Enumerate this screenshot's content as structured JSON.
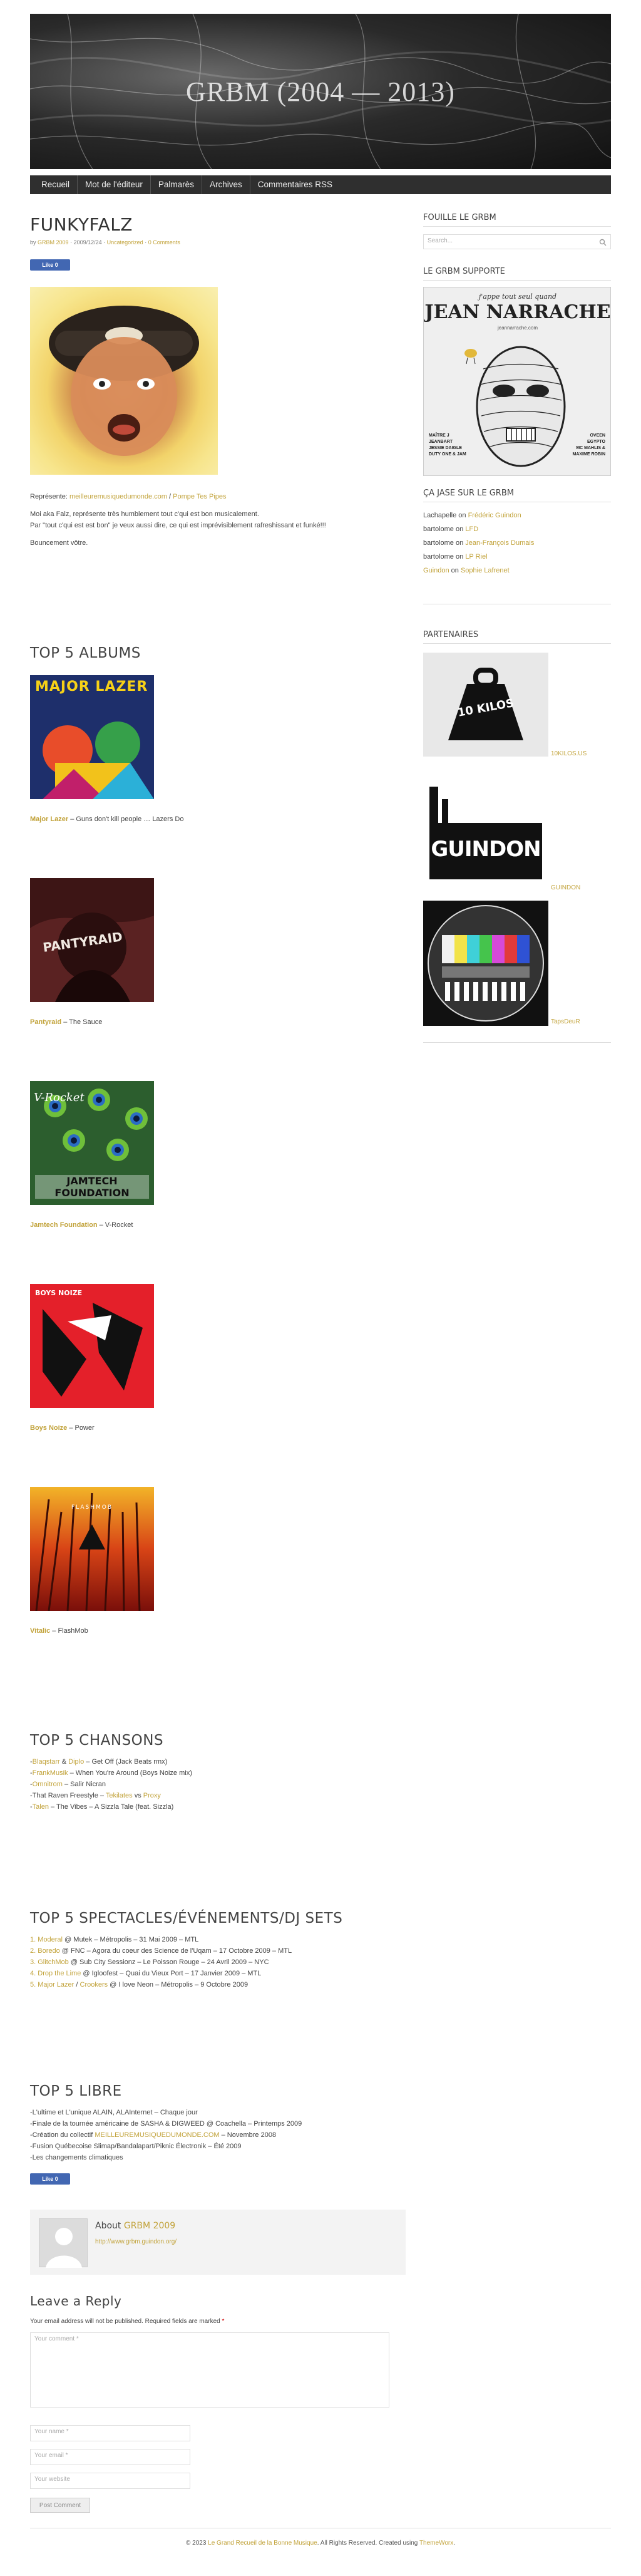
{
  "header": {
    "title": "GRBM (2004 — 2013)"
  },
  "nav": [
    "Recueil",
    "Mot de l'éditeur",
    "Palmarès",
    "Archives",
    "Commentaires RSS"
  ],
  "post": {
    "title": "FUNKYFALZ",
    "meta_by": "by",
    "meta_author": "GRBM 2009",
    "meta_date": "· 2009/12/24 ·",
    "meta_category": "Uncategorized",
    "meta_sep": "·",
    "meta_comments": "0 Comments",
    "like": "Like 0",
    "rep_prefix": "Représente:",
    "rep_link1": "meilleuremusiquedumonde.com",
    "rep_sep": "/",
    "rep_link2": "Pompe Tes Pipes",
    "body1": "Moi aka Falz, représente très humblement tout c'qui est bon musicalement.",
    "body2": "Par \"tout c'qui est est bon\" je veux aussi dire, ce qui est imprévisiblement rafreshissant et funké!!!",
    "body3": "Bouncement vôtre."
  },
  "top_albums": {
    "title": "TOP 5 ALBUMS",
    "items": [
      {
        "artist": "Major Lazer",
        "rest": " – Guns don't kill people … Lazers Do",
        "cover_text": "MAJOR LAZER"
      },
      {
        "artist": "Pantyraid",
        "rest": " – The Sauce",
        "cover_text": "PANTYRAID"
      },
      {
        "artist": "Jamtech Foundation",
        "rest": " – V-Rocket",
        "cover_text": "JAMTECH FOUNDATION"
      },
      {
        "artist": "Boys Noize",
        "rest": " – Power",
        "cover_text": "BOYS NOIZE"
      },
      {
        "artist": "Vitalic",
        "rest": " – FlashMob",
        "cover_text": "FLASHMOB"
      }
    ],
    "cover_text_v_rocket": "V-Rocket"
  },
  "top_songs": {
    "title": "TOP 5 CHANSONS",
    "items": [
      {
        "pre": "-",
        "a1": "Blaqstarr",
        "mid": " & ",
        "a2": "Diplo",
        "rest": " – Get Off (Jack Beats rmx)"
      },
      {
        "pre": "-",
        "a1": "FrankMusik",
        "mid": "",
        "a2": "",
        "rest": " – When You're Around (Boys Noize mix)"
      },
      {
        "pre": "-",
        "a1": "Omnitrom",
        "mid": "",
        "a2": "",
        "rest": " – Salir Nicran"
      },
      {
        "pre": "-That Raven Freestyle – ",
        "a1": "Tekilates",
        "mid": " vs ",
        "a2": "Proxy",
        "rest": ""
      },
      {
        "pre": "-",
        "a1": "Talen",
        "mid": "",
        "a2": "",
        "rest": " – The Vibes – A Sizzla Tale (feat. Sizzla)"
      }
    ]
  },
  "top_shows": {
    "title": "TOP 5 SPECTACLES/ÉVÉNEMENTS/DJ SETS",
    "items": [
      {
        "n": "1.",
        "a1": "Moderal",
        "rest": " @ Mutek – Métropolis – 31 Mai 2009 – MTL"
      },
      {
        "n": "2.",
        "a1": "Boredo",
        "rest": " @ FNC – Agora du coeur des Science de l'Uqam – 17 Octobre 2009 – MTL"
      },
      {
        "n": "3.",
        "a1": "GlitchMob",
        "rest": " @ Sub City Sessionz – Le Poisson Rouge – 24 Avril 2009 – NYC"
      },
      {
        "n": "4.",
        "a1": "Drop the Lime",
        "rest": " @ Igloofest – Quai du Vieux Port – 17 Janvier 2009 – MTL"
      },
      {
        "n": "5.",
        "a1": "Major Lazer",
        "sep": " / ",
        "a2": "Crookers",
        "rest": " @ I love Neon – Métropolis – 9 Octobre 2009"
      }
    ]
  },
  "top_libre": {
    "title": "TOP 5 LIBRE",
    "items": [
      {
        "text": "-L'ultime et L'unique ALAIN, ALAInternet – Chaque jour"
      },
      {
        "text": "-Finale de la tournée américaine de SASHA & DIGWEED @ Coachella – Printemps 2009"
      },
      {
        "pre": "-Création du collectif ",
        "link": "MEILLEUREMUSIQUEDUMONDE.COM",
        "rest": " – Novembre 2008"
      },
      {
        "text": "-Fusion Québecoise Slimap/Bandalapart/Piknic Électronik – Été 2009"
      },
      {
        "text": "-Les changements climatiques"
      }
    ],
    "like": "Like 0"
  },
  "author": {
    "about": "About",
    "name": "GRBM 2009",
    "url": "http://www.grbm.guindon.org/"
  },
  "reply": {
    "title": "Leave a Reply",
    "note": "Your email address will not be published. Required fields are marked",
    "star": "*",
    "comment_ph": "Your comment *",
    "name_ph": "Your name *",
    "email_ph": "Your email *",
    "website_ph": "Your website",
    "submit": "Post Comment"
  },
  "sidebar": {
    "search_title": "FOUILLE LE GRBM",
    "search_ph": "Search...",
    "supporte_title": "LE GRBM SUPPORTE",
    "narrache": {
      "line1": "j'appe tout seul quand",
      "name": "JEAN NARRACHE",
      "url": "jeannarrache.com",
      "left": "MAÎTRE J\nJEANBART\nJESSIE DAIGLE\nDUTY ONE & JAM",
      "right": "OVEEN\nEGYPTO\nMC MAHLIS &\nMAXIME ROBIN"
    },
    "jase_title": "ÇA JASE SUR LE GRBM",
    "comments": [
      {
        "who": "Lachapelle",
        "on": " on ",
        "what": "Frédéric Guindon"
      },
      {
        "who": "bartolome",
        "on": " on ",
        "what": "LFD"
      },
      {
        "who": "bartolome",
        "on": " on ",
        "what": "Jean-François Dumais"
      },
      {
        "who": "bartolome",
        "on": " on ",
        "what": "LP Riel"
      },
      {
        "who_link": "Guindon",
        "on": " on ",
        "what": "Sophie Lafrenet"
      }
    ],
    "partners_title": "PARTENAIRES",
    "partners": [
      {
        "label": "10KILOS.US",
        "logo_text": "10 KILOS"
      },
      {
        "label": "GUINDON",
        "logo_text": "GUINDON"
      },
      {
        "label": "TapsDeuR",
        "logo_text": ""
      }
    ]
  },
  "footer": {
    "pre": "© 2023 ",
    "site": "Le Grand Recueil de la Bonne Musique",
    "mid": ". All Rights Reserved. Created using ",
    "theme": "ThemeWorx",
    "end": "."
  }
}
